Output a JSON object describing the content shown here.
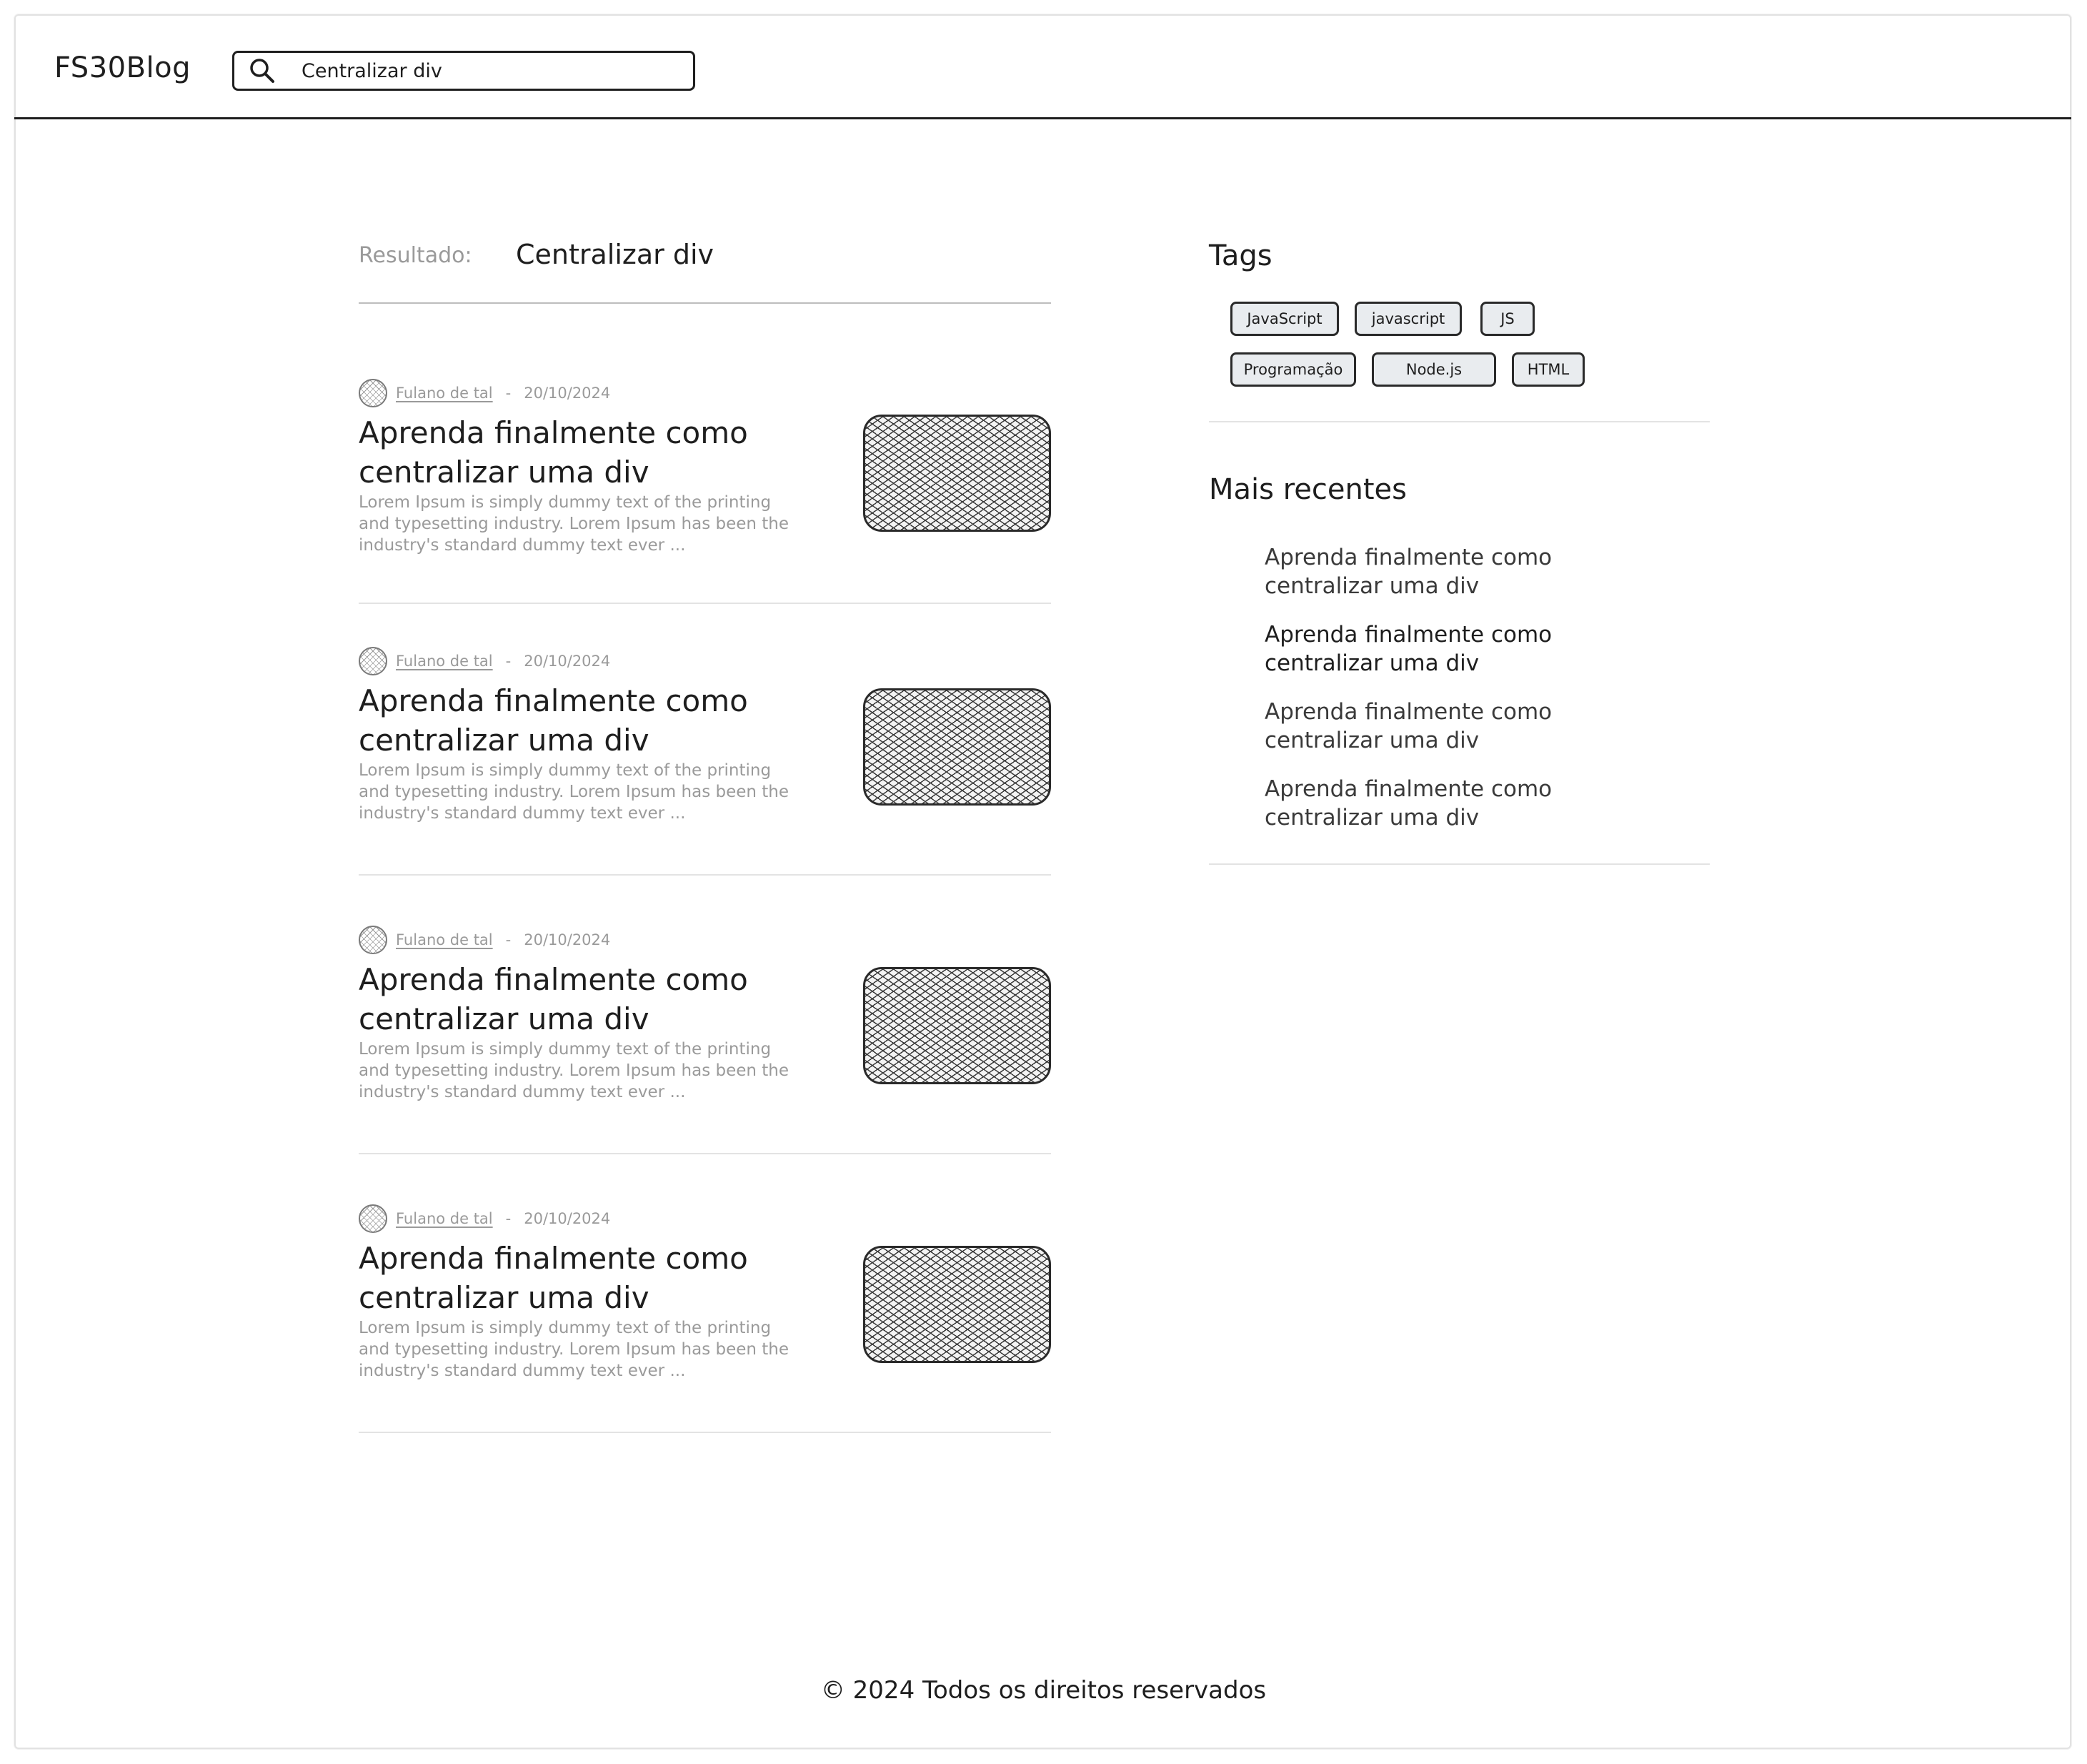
{
  "header": {
    "logo": "FS30Blog",
    "search": {
      "value": "Centralizar div",
      "icon": "search-icon"
    }
  },
  "results": {
    "label": "Resultado:",
    "query": "Centralizar div"
  },
  "posts": [
    {
      "author": "Fulano de tal",
      "separator": "-",
      "date": "20/10/2024",
      "title": "Aprenda finalmente como centralizar uma div",
      "excerpt": "Lorem Ipsum is simply dummy text of the printing and typesetting industry. Lorem Ipsum has been the industry's standard dummy text ever ..."
    },
    {
      "author": "Fulano de tal",
      "separator": "-",
      "date": "20/10/2024",
      "title": "Aprenda finalmente como centralizar uma div",
      "excerpt": "Lorem Ipsum is simply dummy text of the printing and typesetting industry. Lorem Ipsum has been the industry's standard dummy text ever ..."
    },
    {
      "author": "Fulano de tal",
      "separator": "-",
      "date": "20/10/2024",
      "title": "Aprenda finalmente como centralizar uma div",
      "excerpt": "Lorem Ipsum is simply dummy text of the printing and typesetting industry. Lorem Ipsum has been the industry's standard dummy text ever ..."
    },
    {
      "author": "Fulano de tal",
      "separator": "-",
      "date": "20/10/2024",
      "title": "Aprenda finalmente como centralizar uma div",
      "excerpt": "Lorem Ipsum is simply dummy text of the printing and typesetting industry. Lorem Ipsum has been the industry's standard dummy text ever ..."
    }
  ],
  "sidebar": {
    "tags_title": "Tags",
    "tags": [
      "JavaScript",
      "javascript",
      "JS",
      "Programação",
      "Node.js",
      "HTML"
    ],
    "recent_title": "Mais recentes",
    "recent": [
      "Aprenda finalmente como centralizar uma div",
      "Aprenda finalmente como centralizar uma div",
      "Aprenda finalmente como centralizar uma div",
      "Aprenda finalmente como centralizar uma div"
    ]
  },
  "footer": {
    "text": "© 2024 Todos os direitos reservados"
  }
}
